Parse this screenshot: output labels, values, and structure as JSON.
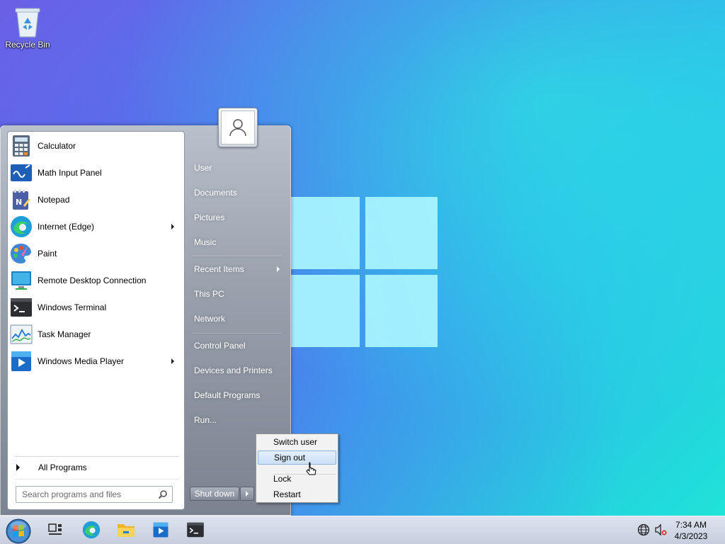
{
  "desktop": {
    "icons": [
      {
        "label": "Recycle Bin",
        "icon": "recycle-bin-icon"
      }
    ]
  },
  "start_menu": {
    "programs": [
      {
        "label": "Calculator",
        "icon": "calculator-icon",
        "has_submenu": false
      },
      {
        "label": "Math Input Panel",
        "icon": "math-input-panel-icon",
        "has_submenu": false
      },
      {
        "label": "Notepad",
        "icon": "notepad-icon",
        "has_submenu": false
      },
      {
        "label": "Internet (Edge)",
        "icon": "edge-icon",
        "has_submenu": true
      },
      {
        "label": "Paint",
        "icon": "paint-icon",
        "has_submenu": false
      },
      {
        "label": "Remote Desktop Connection",
        "icon": "remote-desktop-icon",
        "has_submenu": false
      },
      {
        "label": "Windows Terminal",
        "icon": "terminal-icon",
        "has_submenu": false
      },
      {
        "label": "Task Manager",
        "icon": "task-manager-icon",
        "has_submenu": false
      },
      {
        "label": "Windows Media Player",
        "icon": "media-player-icon",
        "has_submenu": true
      }
    ],
    "all_programs": "All Programs",
    "search_placeholder": "Search programs and files",
    "right_items": [
      {
        "label": "User"
      },
      {
        "label": "Documents"
      },
      {
        "label": "Pictures"
      },
      {
        "label": "Music"
      },
      {
        "label": "Recent Items",
        "has_submenu": true
      },
      {
        "label": "This PC"
      },
      {
        "label": "Network"
      },
      {
        "label": "Control Panel"
      },
      {
        "label": "Devices and Printers"
      },
      {
        "label": "Default Programs"
      },
      {
        "label": "Run..."
      }
    ],
    "shutdown_label": "Shut down"
  },
  "power_menu": {
    "items": [
      {
        "label": "Switch user",
        "highlighted": false
      },
      {
        "label": "Sign out",
        "highlighted": true
      },
      {
        "label": "Lock",
        "highlighted": false
      },
      {
        "label": "Restart",
        "highlighted": false
      }
    ]
  },
  "taskbar": {
    "pinned": [
      "task-view-icon",
      "edge-icon",
      "file-explorer-icon",
      "media-player-icon",
      "terminal-icon"
    ],
    "tray": {
      "time": "7:34 AM",
      "date": "4/3/2023",
      "icons": [
        "network-globe-icon",
        "volume-muted-icon"
      ]
    }
  }
}
